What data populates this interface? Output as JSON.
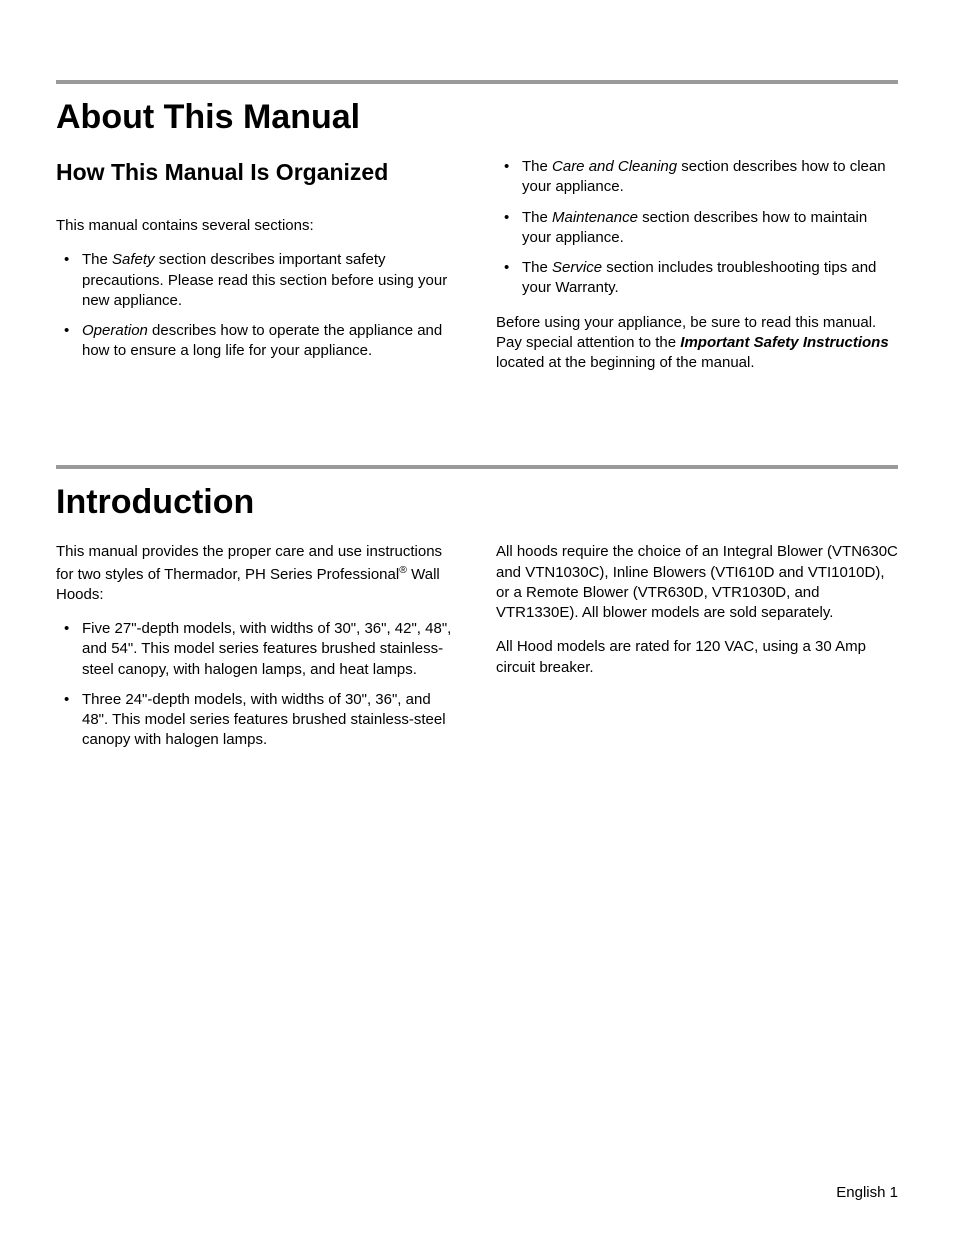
{
  "section1": {
    "heading": "About This Manual",
    "subheading": "How This Manual Is Organized",
    "intro": "This manual contains several sections:",
    "bullets_left": [
      {
        "em": "Safety",
        "prefix": "The ",
        "suffix": " section describes important safety precautions. Please read this section before using your new appliance."
      },
      {
        "em": "Operation",
        "prefix": "",
        "suffix": " describes how to operate the appliance and how to ensure a long life for your appliance."
      }
    ],
    "bullets_right": [
      {
        "em": "Care and Cleaning",
        "prefix": "The ",
        "suffix": " section describes how to clean your appliance."
      },
      {
        "em": "Maintenance",
        "prefix": "The ",
        "suffix": " section describes how to maintain your appliance."
      },
      {
        "em": "Service",
        "prefix": "The ",
        "suffix": " section includes troubleshooting tips and your Warranty."
      }
    ],
    "closing_before": "Before using your appliance, be sure to read this manual. Pay special attention to the ",
    "closing_strong": "Important Safety Instructions",
    "closing_after": " located at the beginning of the manual."
  },
  "section2": {
    "heading": "Introduction",
    "intro_before": "This manual provides the proper care and use instructions for two styles of Thermador, PH Series Professional",
    "intro_sup": "®",
    "intro_after": " Wall Hoods:",
    "bullets": [
      "Five 27\"-depth models, with widths of 30\", 36\", 42\", 48\", and 54\". This model series features brushed stainless-steel canopy, with halogen lamps, and heat lamps.",
      "Three 24\"-depth models, with widths of 30\", 36\", and 48\". This model series features brushed stainless-steel canopy with halogen lamps."
    ],
    "right_p1": "All hoods require the choice of an Integral Blower (VTN630C and VTN1030C), Inline Blowers (VTI610D and VTI1010D), or a Remote Blower (VTR630D, VTR1030D, and VTR1330E). All blower models are sold separately.",
    "right_p2": "All Hood models are rated for 120 VAC, using a 30 Amp circuit breaker."
  },
  "footer": "English 1"
}
